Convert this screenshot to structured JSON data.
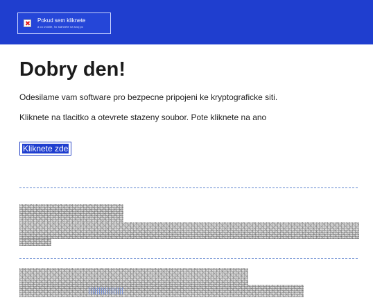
{
  "header": {
    "image_alt": "Pokud sem kliknete",
    "image_subtext": "a co uvidite, ho stahnete na svuj pc"
  },
  "message": {
    "title": "Dobry den!",
    "line1": "Odesilame vam software pro bezpecne pripojeni ke kryptograficke siti.",
    "line2": "Kliknete na tlacitko a otevrete stazeny soubor. Pote kliknete na ano",
    "cta_label": "Kliknete zde"
  },
  "colors": {
    "header_bg": "#1f3ecf",
    "divider": "#5f84cf"
  }
}
